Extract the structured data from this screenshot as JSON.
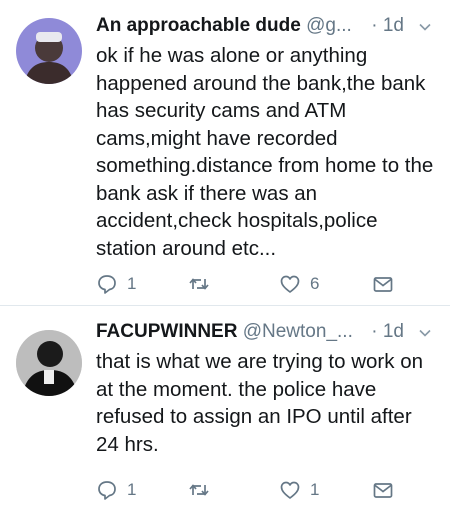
{
  "tweets": [
    {
      "name": "An approachable dude",
      "handle": "@g...",
      "time": "· 1d",
      "text": "ok if he was alone or anything happened around the bank,the bank has security cams and ATM cams,might have recorded something.distance from home to the bank ask if there was an accident,check hospitals,police station around etc...",
      "reply_count": "1",
      "retweet_count": "",
      "like_count": "6"
    },
    {
      "name": "FACUPWINNER",
      "handle": "@Newton_...",
      "time": "· 1d",
      "text": "that is what we are trying to work on at the moment. the police have refused to assign an IPO until after 24 hrs.",
      "reply_count": "1",
      "retweet_count": "",
      "like_count": "1"
    }
  ],
  "icons": {
    "reply": "reply-icon",
    "retweet": "retweet-icon",
    "like": "heart-icon",
    "dm": "envelope-icon",
    "more": "chevron-down-icon"
  },
  "colors": {
    "text": "#14171a",
    "secondary": "#657786",
    "divider": "#e1e8ed"
  }
}
